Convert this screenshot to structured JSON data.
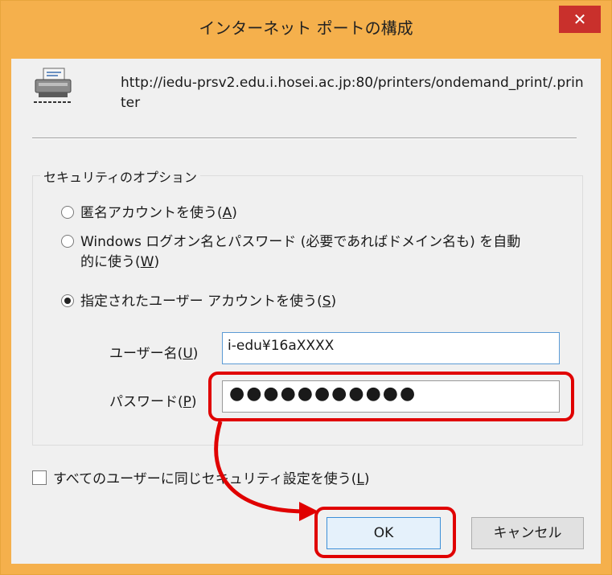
{
  "window": {
    "title": "インターネット ポートの構成",
    "close_glyph": "✕"
  },
  "printer": {
    "url": "http://iedu-prsv2.edu.i.hosei.ac.jp:80/printers/ondemand_print/.printer"
  },
  "security": {
    "group_label": "セキュリティのオプション",
    "options": [
      {
        "label": "匿名アカウントを使う",
        "mnemonic": "A",
        "selected": false
      },
      {
        "label": "Windows ログオン名とパスワード (必要であればドメイン名も) を自動的に使う",
        "mnemonic": "W",
        "selected": false
      },
      {
        "label": "指定されたユーザー アカウントを使う",
        "mnemonic": "S",
        "selected": true
      }
    ],
    "username": {
      "label": "ユーザー名",
      "mnemonic": "U",
      "value": "i-edu¥16aXXXX"
    },
    "password": {
      "label": "パスワード",
      "mnemonic": "P",
      "value": "●●●●●●●●●●●"
    }
  },
  "same_for_all": {
    "label": "すべてのユーザーに同じセキュリティ設定を使う",
    "mnemonic": "L",
    "checked": false
  },
  "buttons": {
    "ok": "OK",
    "cancel": "キャンセル"
  },
  "colors": {
    "titlebar": "#f5b04c",
    "close": "#c9302c",
    "annotation": "#e00000"
  },
  "icons": {
    "printer": "printer-icon",
    "close": "close-icon"
  }
}
